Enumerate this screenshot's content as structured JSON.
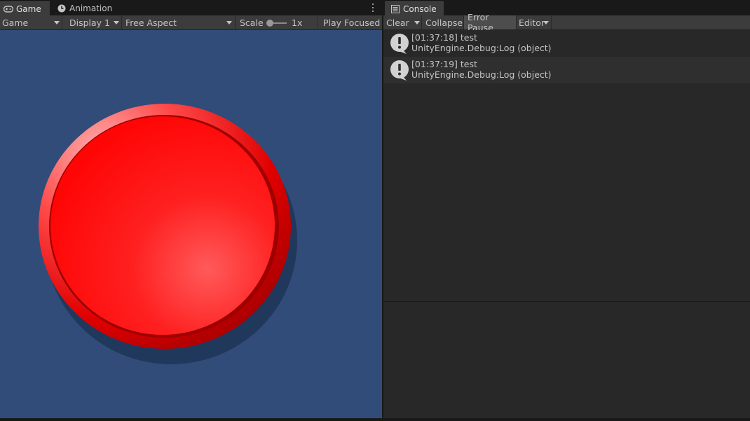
{
  "game_panel": {
    "tabs": [
      {
        "label": "Game",
        "icon": "gamepad-icon"
      },
      {
        "label": "Animation",
        "icon": "clock-icon"
      }
    ],
    "toolbar": {
      "view_mode": "Game",
      "display": "Display 1",
      "aspect": "Free Aspect",
      "scale_label": "Scale",
      "scale_value": "1x",
      "play_mode": "Play Focused"
    },
    "scene": {
      "background_color": "#314c78",
      "button_color": "#ff1010"
    }
  },
  "console_panel": {
    "tab_label": "Console",
    "toolbar": {
      "clear": "Clear",
      "collapse": "Collapse",
      "error_pause": "Error Pause",
      "editor": "Editor"
    },
    "logs": [
      {
        "line1": "[01:37:18] test",
        "line2": "UnityEngine.Debug:Log (object)",
        "icon": "info-bubble-icon"
      },
      {
        "line1": "[01:37:19] test",
        "line2": "UnityEngine.Debug:Log (object)",
        "icon": "info-bubble-icon"
      }
    ]
  }
}
